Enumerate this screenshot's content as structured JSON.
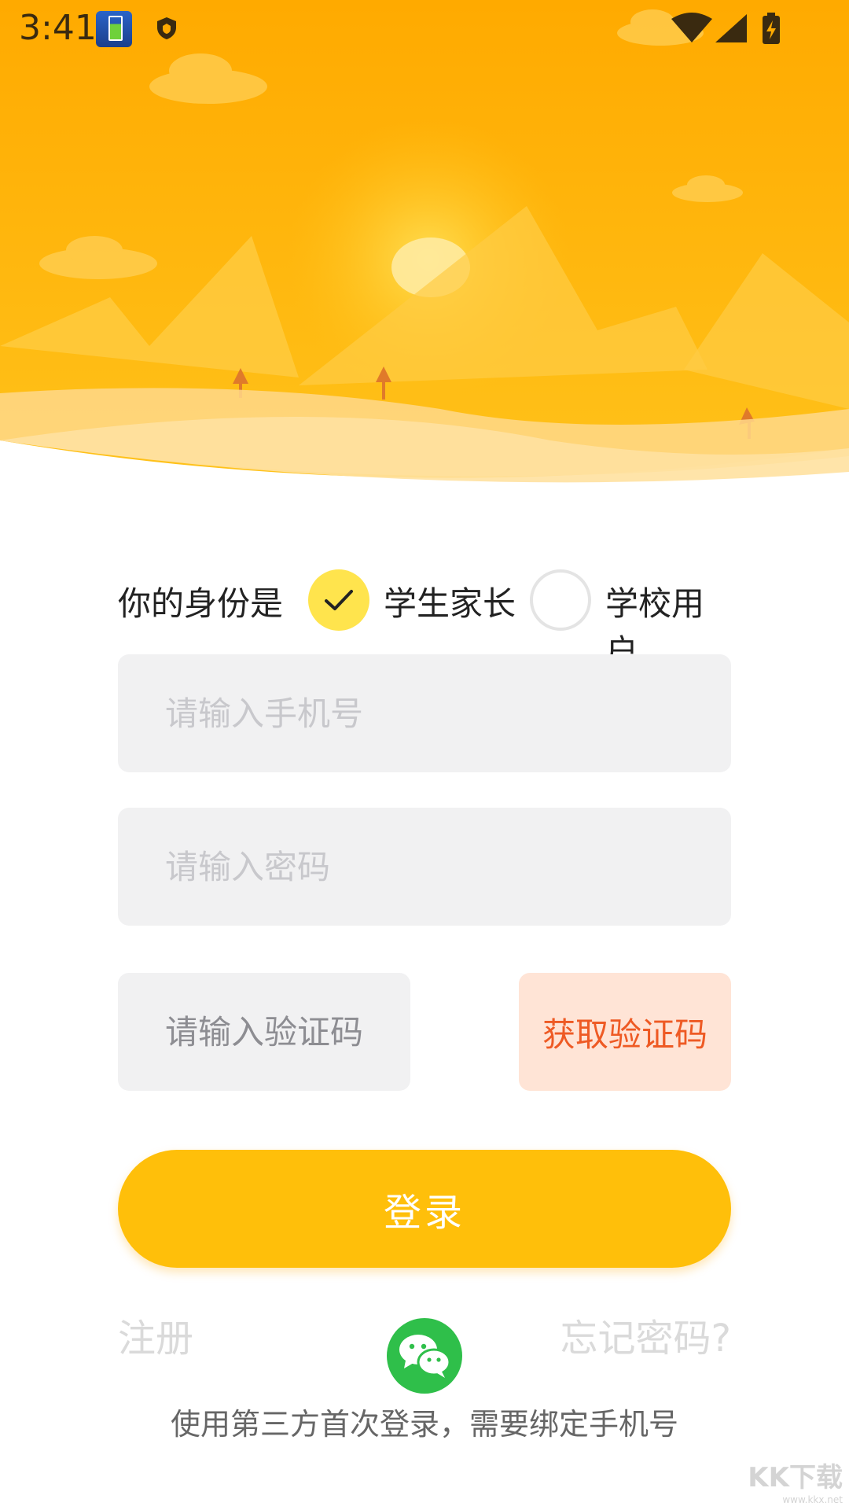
{
  "status_bar": {
    "time": "3:41",
    "icons": [
      "battery-app-icon",
      "shield-icon",
      "wifi-icon",
      "signal-icon",
      "battery-charging-icon"
    ]
  },
  "identity": {
    "label": "你的身份是",
    "options": [
      {
        "label": "学生家长",
        "selected": true
      },
      {
        "label": "学校用户",
        "selected": false
      }
    ]
  },
  "form": {
    "phone_placeholder": "请输入手机号",
    "password_placeholder": "请输入密码",
    "code_placeholder": "请输入验证码",
    "get_code_label": "获取验证码",
    "login_label": "登录"
  },
  "links": {
    "register": "注册",
    "forgot_password": "忘记密码?"
  },
  "third_party": {
    "icon": "wechat-icon",
    "note": "使用第三方首次登录，需要绑定手机号"
  },
  "watermark": {
    "text": "KK下载",
    "url": "www.kkx.net"
  },
  "colors": {
    "accent": "#ffbf0a",
    "check": "#ffe44d",
    "get_code_bg": "#ffe4d6",
    "get_code_text": "#ee5a24",
    "wechat": "#2fbf4a"
  }
}
